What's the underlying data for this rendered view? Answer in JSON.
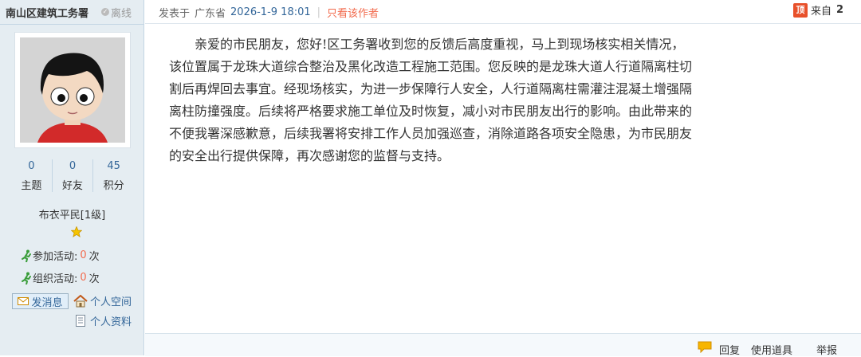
{
  "author": {
    "name": "南山区建筑工务署",
    "status": "离线"
  },
  "post": {
    "posted_prefix": "发表于",
    "location": "广东省",
    "date": "2026-1-9 18:01",
    "only_author": "只看该作者",
    "floor_label": "来自",
    "floor_num": "2",
    "top_icon": "顶",
    "body": "亲爱的市民朋友，您好!区工务署收到您的反馈后高度重视，马上到现场核实相关情况，该位置属于龙珠大道综合整治及黑化改造工程施工范围。您反映的是龙珠大道人行道隔离柱切割后再焊回去事宜。经现场核实，为进一步保障行人安全，人行道隔离柱需灌注混凝土增强隔离柱防撞强度。后续将严格要求施工单位及时恢复，减小对市民朋友出行的影响。由此带来的不便我署深感歉意，后续我署将安排工作人员加强巡查，消除道路各项安全隐患，为市民朋友的安全出行提供保障，再次感谢您的监督与支持。"
  },
  "stats": [
    {
      "num": "0",
      "label": "主题"
    },
    {
      "num": "0",
      "label": "好友"
    },
    {
      "num": "45",
      "label": "积分"
    }
  ],
  "rank": "布衣平民[1级]",
  "activities": {
    "join_label": "参加活动:",
    "join_count": "0",
    "org_label": "组织活动:",
    "org_count": "0",
    "unit": "次"
  },
  "actions": {
    "send_msg": "发消息",
    "space": "个人空间",
    "profile": "个人资料"
  },
  "footer": {
    "reply": "回复",
    "tools": "使用道具",
    "report": "举报"
  },
  "colors": {
    "accent": "#336699",
    "red": "#f26c4f",
    "sidebar_bg": "#e5edf2"
  }
}
